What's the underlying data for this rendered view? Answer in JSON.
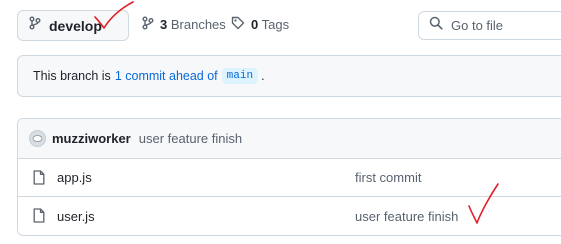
{
  "header": {
    "branch_name": "develop",
    "branches_count": "3",
    "branches_label": "Branches",
    "tags_count": "0",
    "tags_label": "Tags",
    "search_placeholder": "Go to file"
  },
  "ahead_banner": {
    "prefix": "This branch is",
    "link_text": "1 commit ahead of",
    "base_branch": "main",
    "suffix": "."
  },
  "latest_commit": {
    "author": "muzziworker",
    "message": "user feature finish"
  },
  "files": [
    {
      "name": "app.js",
      "commit_message": "first commit"
    },
    {
      "name": "user.js",
      "commit_message": "user feature finish"
    }
  ],
  "colors": {
    "link": "#0969da",
    "muted": "#59636e",
    "annotation": "#e0202a"
  },
  "icons": [
    "branch-icon",
    "tag-icon",
    "search-icon",
    "file-icon",
    "avatar"
  ]
}
